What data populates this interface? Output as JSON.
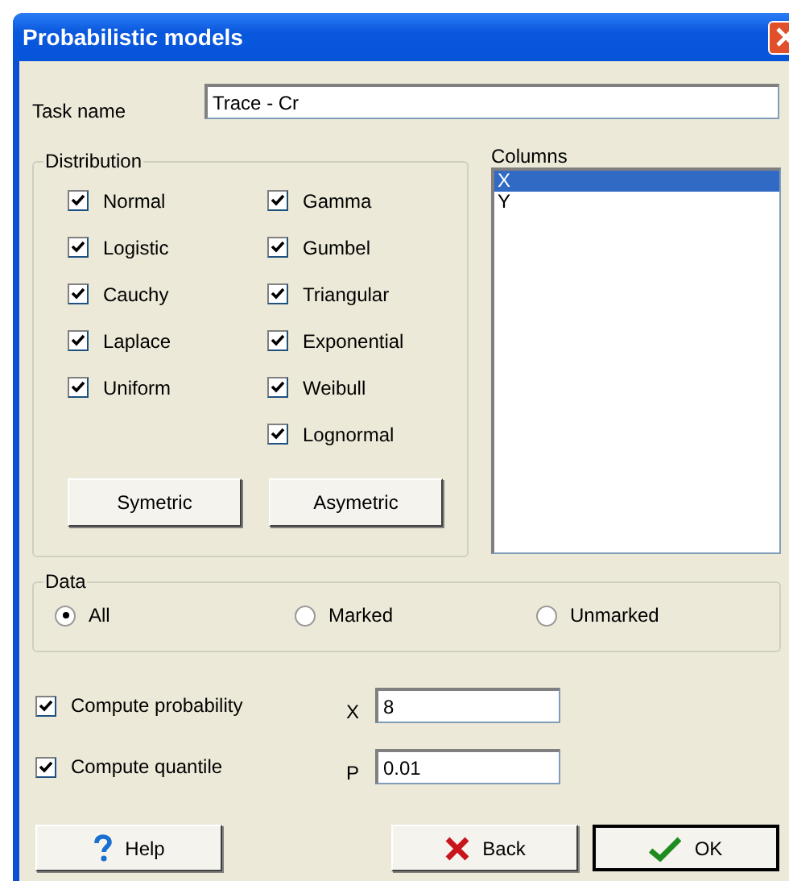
{
  "window": {
    "title": "Probabilistic models"
  },
  "task_name": {
    "label": "Task name",
    "value": "Trace - Cr"
  },
  "distribution": {
    "title": "Distribution",
    "columns": [
      [
        {
          "label": "Normal",
          "checked": true
        },
        {
          "label": "Logistic",
          "checked": true
        },
        {
          "label": "Cauchy",
          "checked": true
        },
        {
          "label": "Laplace",
          "checked": true
        },
        {
          "label": "Uniform",
          "checked": true
        }
      ],
      [
        {
          "label": "Gamma",
          "checked": true
        },
        {
          "label": "Gumbel",
          "checked": true
        },
        {
          "label": "Triangular",
          "checked": true
        },
        {
          "label": "Exponential",
          "checked": true
        },
        {
          "label": "Weibull",
          "checked": true
        },
        {
          "label": "Lognormal",
          "checked": true
        }
      ]
    ],
    "buttons": [
      "Symetric",
      "Asymetric"
    ]
  },
  "columns": {
    "label": "Columns",
    "items": [
      {
        "label": "X",
        "selected": true
      },
      {
        "label": "Y",
        "selected": false
      }
    ]
  },
  "data": {
    "title": "Data",
    "options": [
      {
        "label": "All",
        "selected": true
      },
      {
        "label": "Marked",
        "selected": false
      },
      {
        "label": "Unmarked",
        "selected": false
      }
    ]
  },
  "compute": [
    {
      "label": "Compute probability",
      "checked": true,
      "symbol": "X",
      "value": "8"
    },
    {
      "label": "Compute quantile",
      "checked": true,
      "symbol": "P",
      "value": "0.01"
    }
  ],
  "buttons": [
    {
      "kind": "help",
      "label": "Help",
      "default": false
    },
    {
      "kind": "back",
      "label": "Back",
      "default": false
    },
    {
      "kind": "ok",
      "label": "OK",
      "default": true
    }
  ]
}
